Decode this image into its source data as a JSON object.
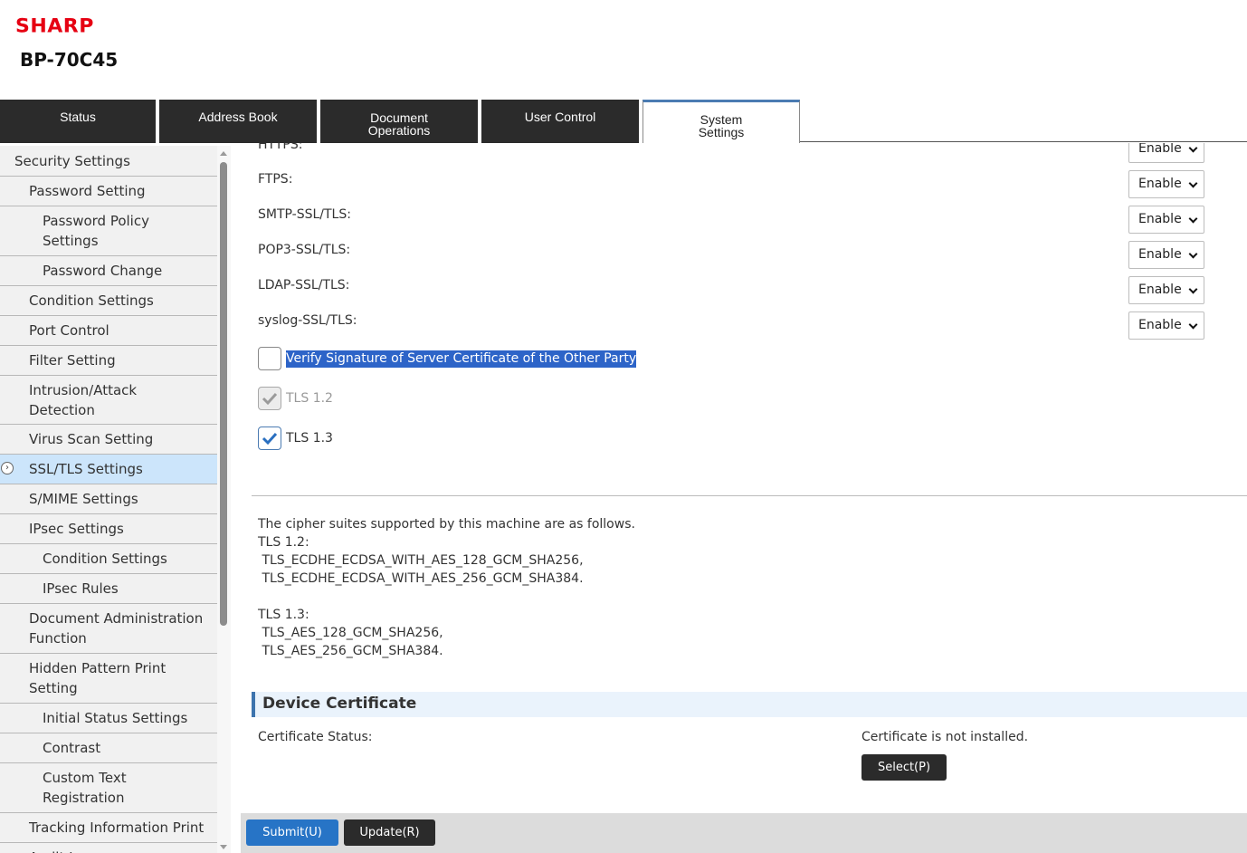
{
  "header": {
    "brand": "SHARP",
    "model": "BP-70C45"
  },
  "tabs": [
    {
      "label": "Status"
    },
    {
      "label": "Address Book"
    },
    {
      "label": "Document\nOperations"
    },
    {
      "label": "User Control"
    },
    {
      "label": "System\nSettings",
      "active": true
    }
  ],
  "sidebar": {
    "items": [
      {
        "label": "Security Settings",
        "level": 0
      },
      {
        "label": "Password Setting",
        "level": 1
      },
      {
        "label": "Password Policy Settings",
        "level": 2
      },
      {
        "label": "Password Change",
        "level": 2
      },
      {
        "label": "Condition Settings",
        "level": 1
      },
      {
        "label": "Port Control",
        "level": 1
      },
      {
        "label": "Filter Setting",
        "level": 1
      },
      {
        "label": "Intrusion/Attack Detection",
        "level": 1
      },
      {
        "label": "Virus Scan Setting",
        "level": 1
      },
      {
        "label": "SSL/TLS Settings",
        "level": 1,
        "selected": true
      },
      {
        "label": "S/MIME Settings",
        "level": 1
      },
      {
        "label": "IPsec Settings",
        "level": 1
      },
      {
        "label": "Condition Settings",
        "level": 2
      },
      {
        "label": "IPsec Rules",
        "level": 2
      },
      {
        "label": "Document Administration Function",
        "level": 1
      },
      {
        "label": "Hidden Pattern Print Setting",
        "level": 1
      },
      {
        "label": "Initial Status Settings",
        "level": 2
      },
      {
        "label": "Contrast",
        "level": 2
      },
      {
        "label": "Custom Text Registration",
        "level": 2
      },
      {
        "label": "Tracking Information Print",
        "level": 1
      },
      {
        "label": "Audit Log",
        "level": 1
      }
    ]
  },
  "protocols": [
    {
      "label": "HTTPS:",
      "value": "Enable"
    },
    {
      "label": "FTPS:",
      "value": "Enable"
    },
    {
      "label": "SMTP-SSL/TLS:",
      "value": "Enable"
    },
    {
      "label": "POP3-SSL/TLS:",
      "value": "Enable"
    },
    {
      "label": "LDAP-SSL/TLS:",
      "value": "Enable"
    },
    {
      "label": "syslog-SSL/TLS:",
      "value": "Enable"
    }
  ],
  "checkboxes": [
    {
      "label": "Verify Signature of Server Certificate of the Other Party",
      "checked": false,
      "highlighted": true
    },
    {
      "label": "TLS 1.2",
      "checked": true,
      "disabled": true
    },
    {
      "label": "TLS 1.3",
      "checked": true
    }
  ],
  "cipher_info": {
    "intro": "The cipher suites supported by this machine are as follows.",
    "tls12_label": "TLS 1.2:",
    "tls12_suites": " TLS_ECDHE_ECDSA_WITH_AES_128_GCM_SHA256,\n TLS_ECDHE_ECDSA_WITH_AES_256_GCM_SHA384.",
    "tls13_label": "TLS 1.3:",
    "tls13_suites": " TLS_AES_128_GCM_SHA256,\n TLS_AES_256_GCM_SHA384."
  },
  "device_certificate": {
    "title": "Device Certificate",
    "status_label": "Certificate Status:",
    "status_value": "Certificate is not installed.",
    "select_button": "Select(P)"
  },
  "footer": {
    "submit_label": "Submit(U)",
    "update_label": "Update(R)"
  },
  "colors": {
    "brand": "#e60012",
    "tab_dark": "#2b2b2b",
    "selected_nav": "#cce5fb",
    "accent_blue": "#2774c6",
    "section_bar": "#3d74ae"
  }
}
